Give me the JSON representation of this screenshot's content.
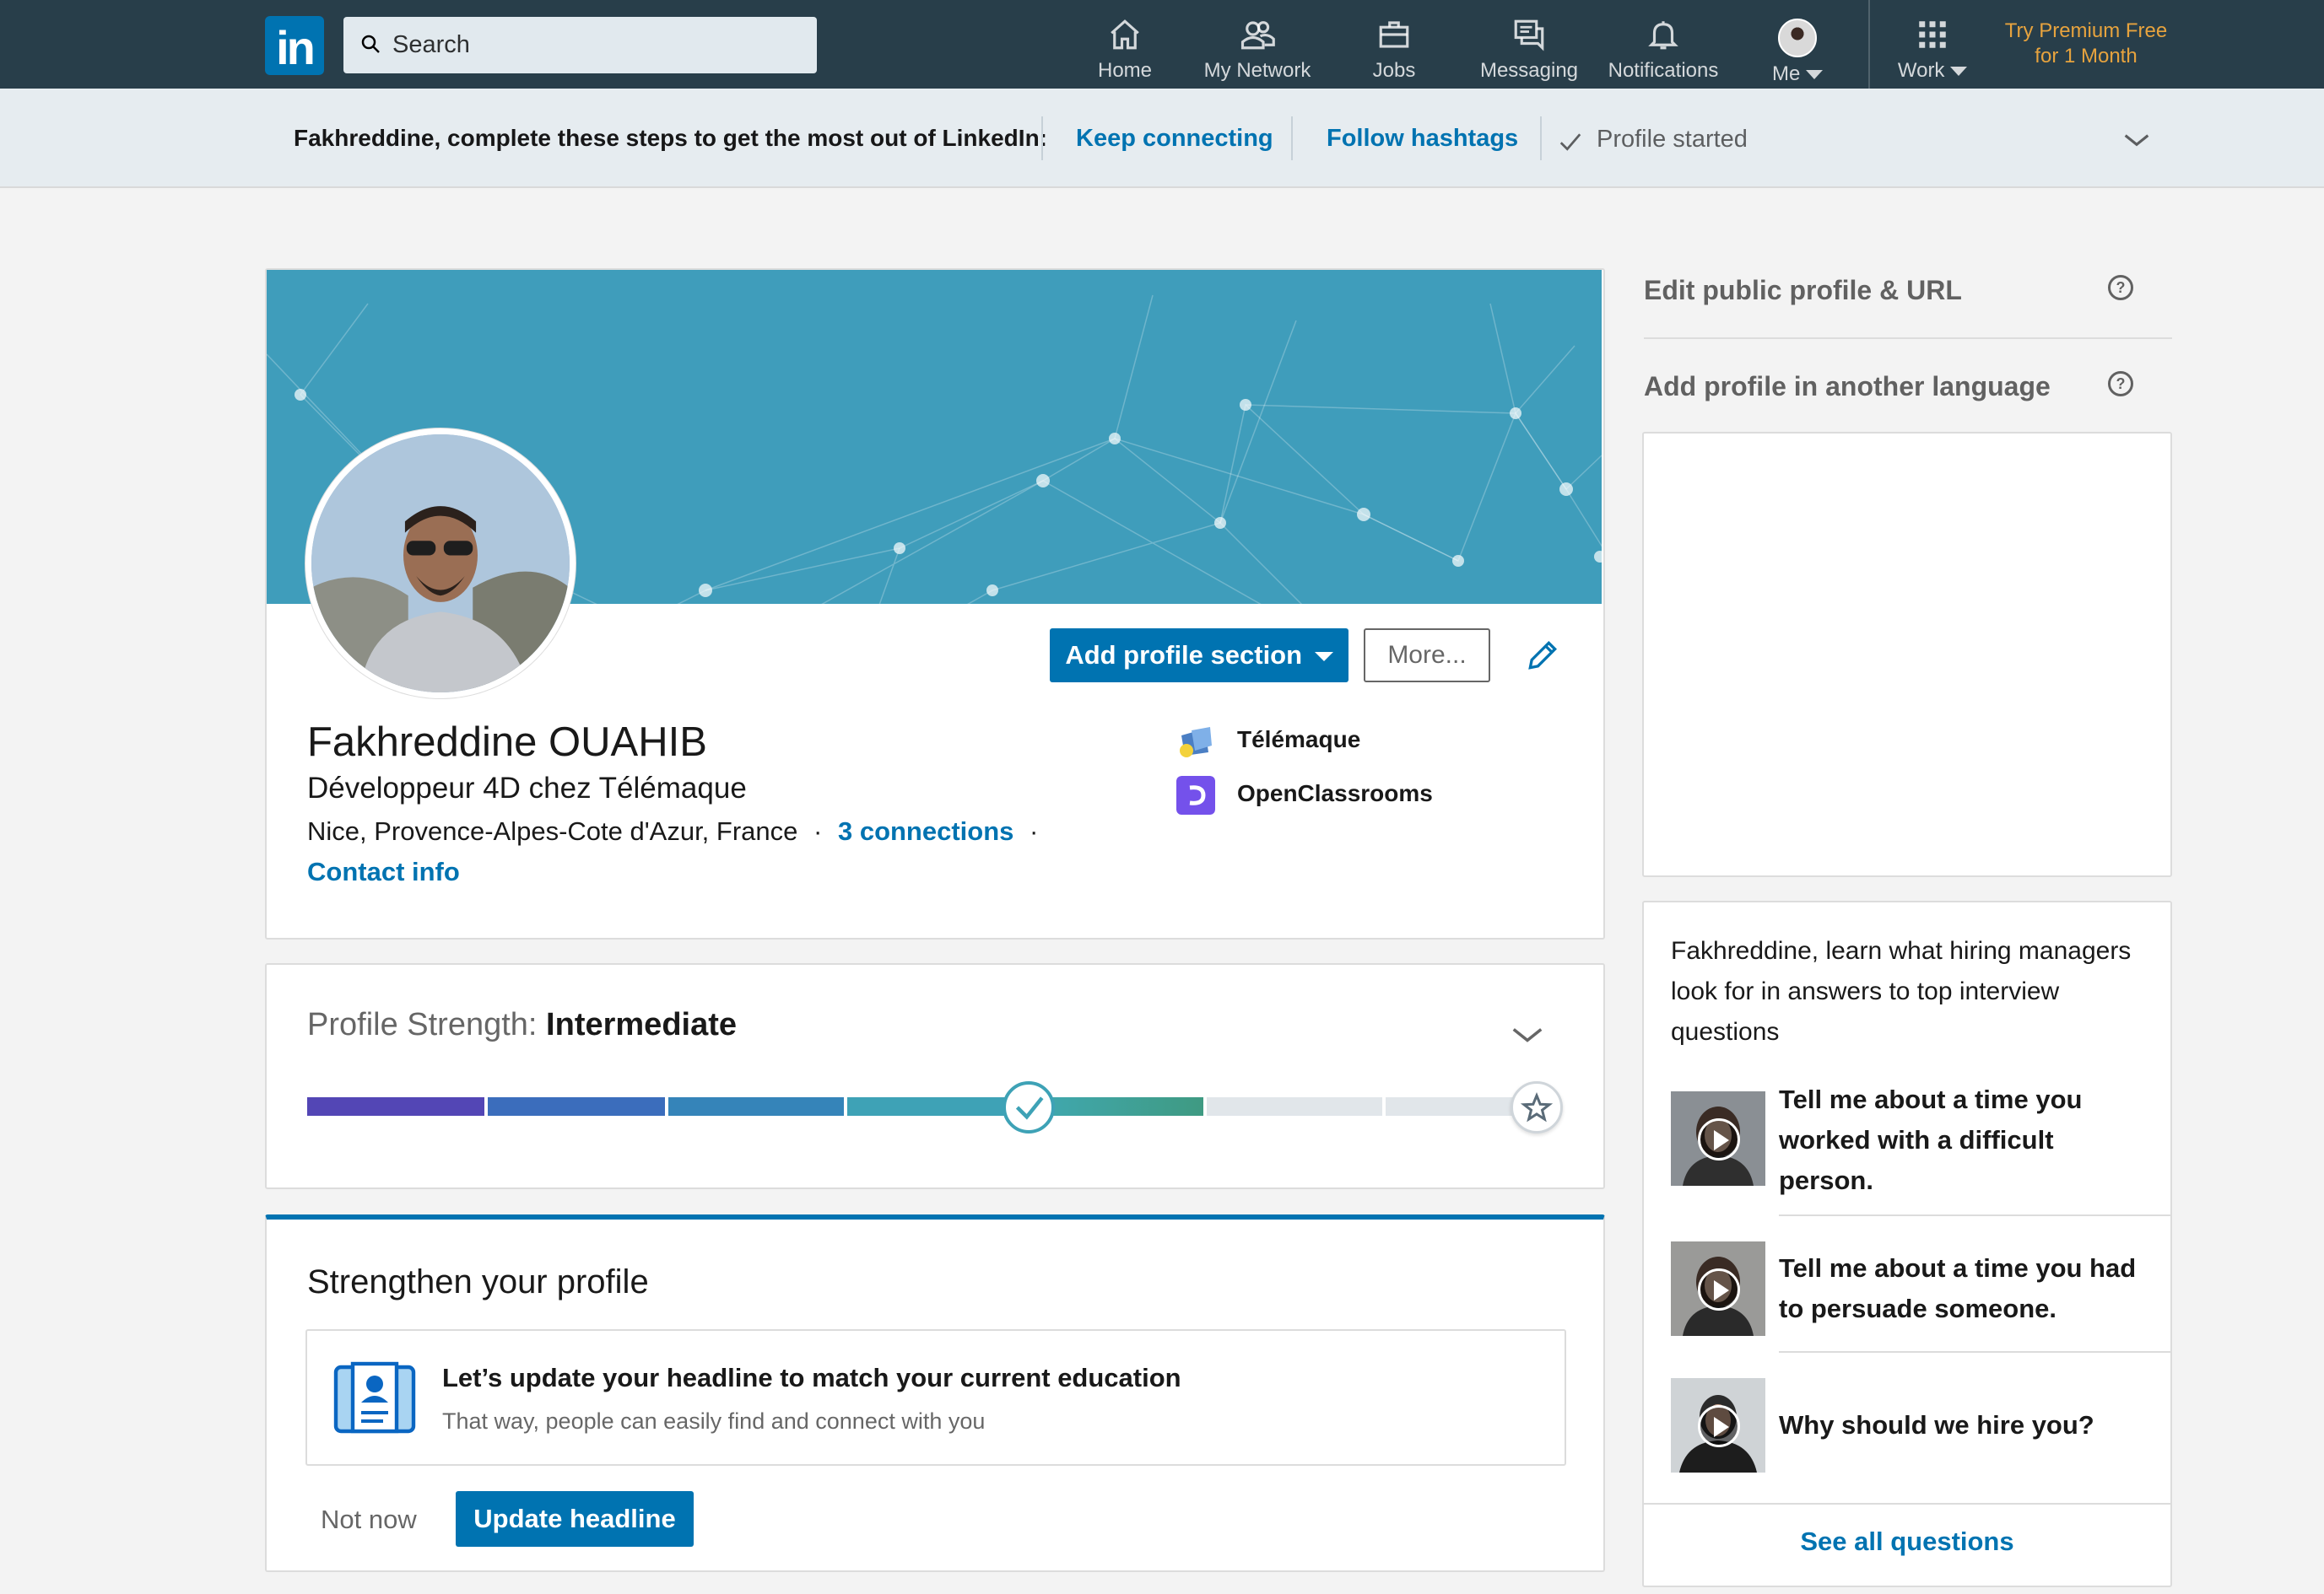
{
  "nav": {
    "search_placeholder": "Search",
    "items": [
      {
        "label": "Home",
        "icon": "home-icon"
      },
      {
        "label": "My Network",
        "icon": "network-icon"
      },
      {
        "label": "Jobs",
        "icon": "briefcase-icon"
      },
      {
        "label": "Messaging",
        "icon": "messaging-icon"
      },
      {
        "label": "Notifications",
        "icon": "bell-icon"
      },
      {
        "label": "Me",
        "icon": "avatar"
      },
      {
        "label": "Work",
        "icon": "grid-icon"
      }
    ],
    "premium_line1": "Try Premium Free",
    "premium_line2": "for 1 Month"
  },
  "banner": {
    "message": "Fakhreddine, complete these steps to get the most out of LinkedIn:",
    "step1": "Keep connecting",
    "step2": "Follow hashtags",
    "step3": "Profile started"
  },
  "profile": {
    "name": "Fakhreddine OUAHIB",
    "headline": "Développeur 4D chez Télémaque",
    "location": "Nice, Provence-Alpes-Cote d'Azur, France",
    "connections": "3 connections",
    "contact": "Contact info",
    "add_section": "Add profile section",
    "more": "More...",
    "orgs": [
      {
        "name": "Télémaque"
      },
      {
        "name": "OpenClassrooms"
      }
    ]
  },
  "strength": {
    "label": "Profile Strength:",
    "level": "Intermediate",
    "level_fraction": 0.6
  },
  "strengthen": {
    "title": "Strengthen your profile",
    "tip_title": "Let’s update your headline to match your current education",
    "tip_body": "That way, people can easily find and connect with you",
    "not_now": "Not now",
    "update": "Update headline"
  },
  "sidebar": {
    "edit_public": "Edit public profile & URL",
    "add_language": "Add profile in another language",
    "interview_intro": "Fakhreddine, learn what hiring managers look for in answers to top interview questions",
    "questions": [
      "Tell me about a time you worked with a difficult person.",
      "Tell me about a time you had to persuade someone.",
      "Why should we hire you?"
    ],
    "see_all": "See all questions"
  },
  "colors": {
    "nav_bg": "#283e4a",
    "brand": "#0073b1",
    "premium": "#e7a33e"
  }
}
